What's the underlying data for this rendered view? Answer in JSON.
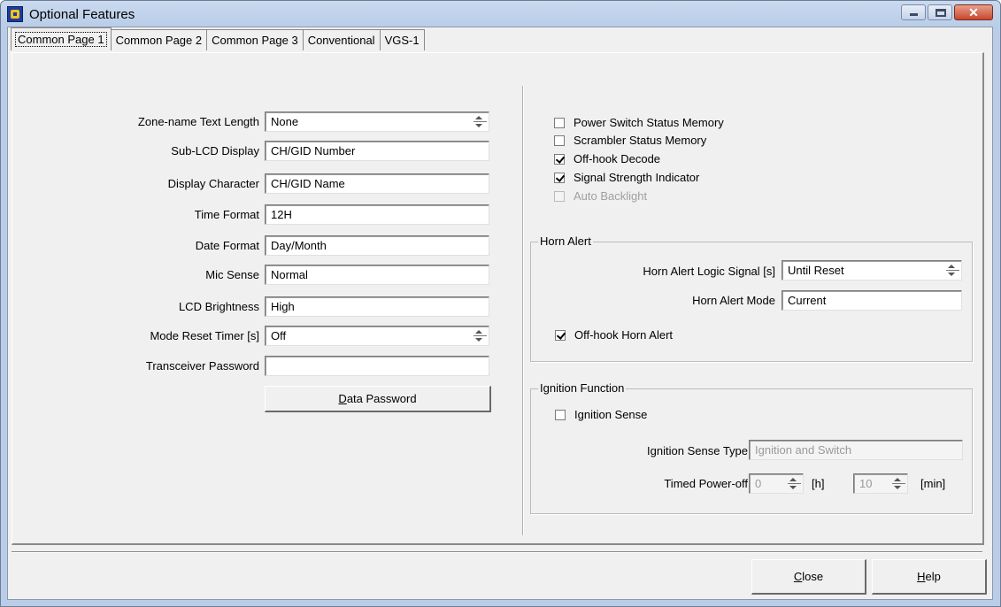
{
  "window": {
    "title": "Optional Features"
  },
  "tabs": [
    "Common Page 1",
    "Common Page 2",
    "Common Page 3",
    "Conventional",
    "VGS-1"
  ],
  "left": {
    "fields": [
      {
        "label": "Zone-name Text Length",
        "value": "None",
        "spin": true
      },
      {
        "label": "Sub-LCD Display",
        "value": "CH/GID Number",
        "spin": false
      },
      {
        "label": "Display Character",
        "value": "CH/GID Name",
        "spin": false
      },
      {
        "label": "Time Format",
        "value": "12H",
        "spin": false
      },
      {
        "label": "Date Format",
        "value": "Day/Month",
        "spin": false
      },
      {
        "label": "Mic Sense",
        "value": "Normal",
        "spin": false
      },
      {
        "label": "LCD Brightness",
        "value": "High",
        "spin": false
      },
      {
        "label": "Mode Reset Timer [s]",
        "value": "Off",
        "spin": true
      },
      {
        "label": "Transceiver Password",
        "value": "",
        "spin": false
      }
    ],
    "data_password_button": {
      "accel": "D",
      "rest": "ata Password"
    }
  },
  "right": {
    "checkboxes": [
      {
        "label": "Power Switch Status Memory",
        "checked": false,
        "disabled": false
      },
      {
        "label": "Scrambler Status Memory",
        "checked": false,
        "disabled": false
      },
      {
        "label": "Off-hook Decode",
        "checked": true,
        "disabled": false
      },
      {
        "label": "Signal Strength Indicator",
        "checked": true,
        "disabled": false
      },
      {
        "label": "Auto Backlight",
        "checked": false,
        "disabled": true
      }
    ],
    "horn_alert": {
      "title": "Horn Alert",
      "logic_signal_label": "Horn Alert Logic Signal [s]",
      "logic_signal_value": "Until Reset",
      "mode_label": "Horn Alert Mode",
      "mode_value": "Current",
      "offhook_label": "Off-hook Horn Alert",
      "offhook_checked": true
    },
    "ignition": {
      "title": "Ignition Function",
      "sense_label": "Ignition Sense",
      "sense_checked": false,
      "type_label": "Ignition Sense Type",
      "type_value": "Ignition and Switch",
      "timed_label": "Timed Power-off",
      "hours_value": "0",
      "hours_unit": "[h]",
      "minutes_value": "10",
      "minutes_unit": "[min]"
    }
  },
  "footer": {
    "close_button": {
      "accel": "C",
      "rest": "lose"
    },
    "help_button": {
      "accel": "H",
      "rest": "elp"
    }
  }
}
